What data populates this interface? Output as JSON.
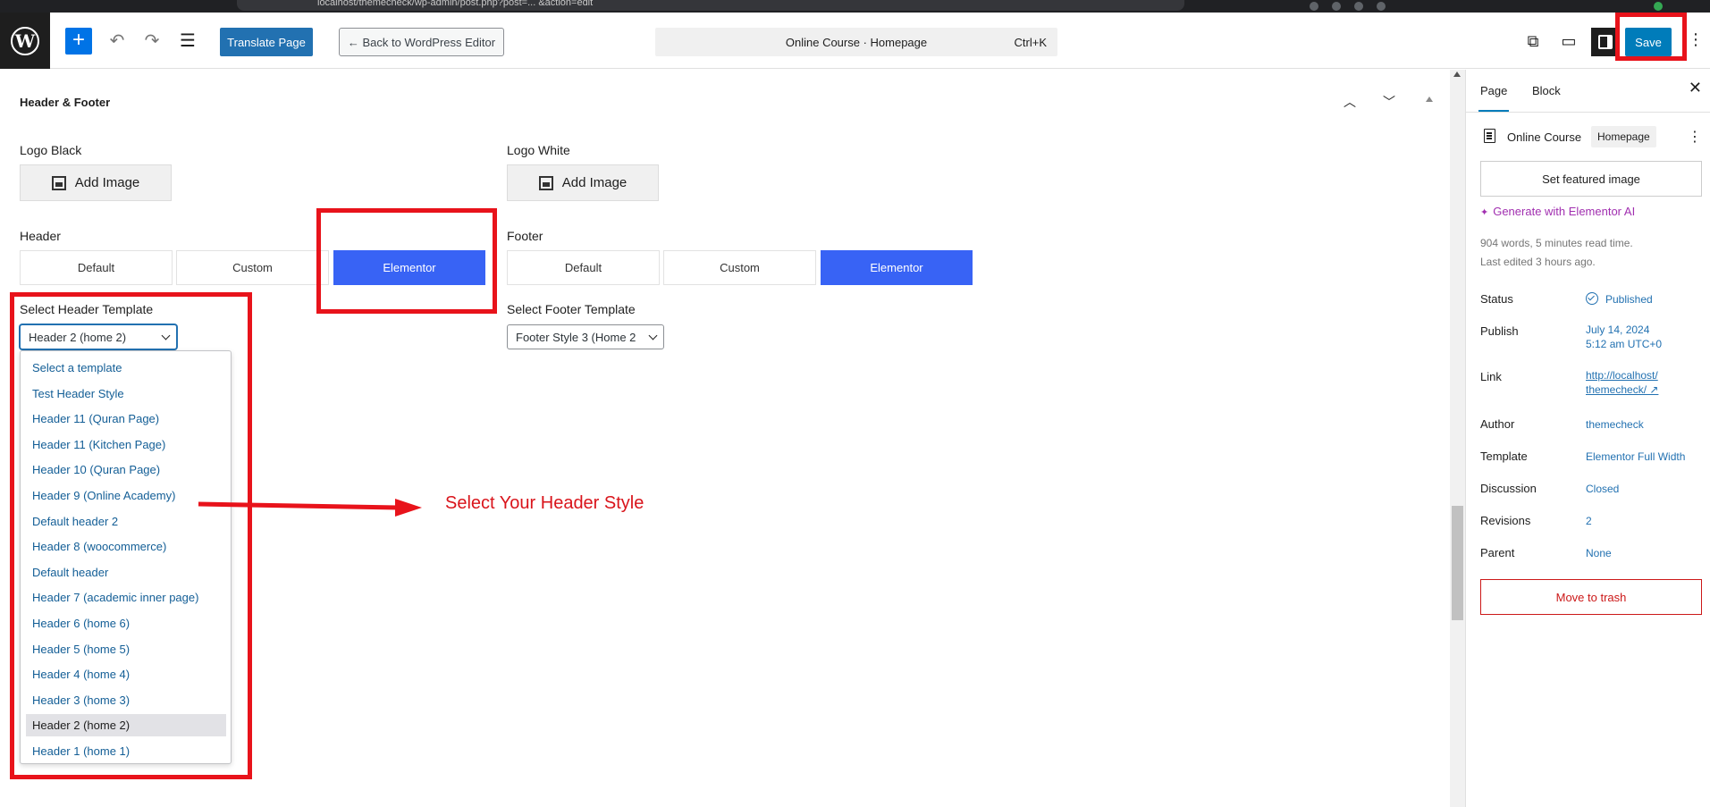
{
  "browser": {
    "url_text": "localhost/themecheck/wp-admin/post.php?post=... &action=edit"
  },
  "toolbar": {
    "add_label": "+",
    "translate_label": "Translate Page",
    "back_label": "← Back to WordPress Editor",
    "command_title": "Online Course · Homepage",
    "command_shortcut": "Ctrl+K",
    "save_label": "Save"
  },
  "section": {
    "title": "Header & Footer"
  },
  "logos": {
    "black_label": "Logo Black",
    "white_label": "Logo White",
    "add_image_label": "Add Image"
  },
  "header": {
    "label": "Header",
    "options": [
      "Default",
      "Custom",
      "Elementor"
    ],
    "active": "Elementor",
    "template_label": "Select Header Template",
    "template_value": "Header 2 (home 2)"
  },
  "footer": {
    "label": "Footer",
    "options": [
      "Default",
      "Custom",
      "Elementor"
    ],
    "active": "Elementor",
    "template_label": "Select Footer Template",
    "template_value": "Footer Style 3 (Home 2"
  },
  "dropdown": {
    "options": [
      "Select a template",
      "Test Header Style",
      "Header 11 (Quran Page)",
      "Header 11 (Kitchen Page)",
      "Header 10 (Quran Page)",
      "Header 9 (Online Academy)",
      "Default header 2",
      "Header 8 (woocommerce)",
      "Default header",
      "Header 7 (academic inner page)",
      "Header 6 (home 6)",
      "Header 5 (home 5)",
      "Header 4 (home 4)",
      "Header 3 (home 3)",
      "Header 2 (home 2)",
      "Header 1 (home 1)"
    ],
    "selected_index": 14
  },
  "annotation": {
    "text": "Select Your Header Style",
    "color": "#d9141b"
  },
  "sidebar": {
    "tab_page": "Page",
    "tab_block": "Block",
    "doc_title": "Online Course",
    "doc_badge": "Homepage",
    "featured_image_label": "Set featured image",
    "gen_ai_label": "Generate with Elementor AI",
    "words_line": "904 words, 5 minutes read time.",
    "edited_line": "Last edited 3 hours ago.",
    "props": {
      "status_label": "Status",
      "status_value": "Published",
      "publish_label": "Publish",
      "publish_date": "July 14, 2024",
      "publish_time": "5:12 am UTC+0",
      "link_label": "Link",
      "link_line1": "http://localhost/",
      "link_line2": "themecheck/ ↗",
      "author_label": "Author",
      "author_value": "themecheck",
      "template_label": "Template",
      "template_value": "Elementor Full Width",
      "discussion_label": "Discussion",
      "discussion_value": "Closed",
      "revisions_label": "Revisions",
      "revisions_value": "2",
      "parent_label": "Parent",
      "parent_value": "None"
    },
    "trash_label": "Move to trash"
  },
  "colors": {
    "accent": "#3863f5",
    "wp_blue": "#007cba",
    "highlight_red": "#e8131b"
  }
}
